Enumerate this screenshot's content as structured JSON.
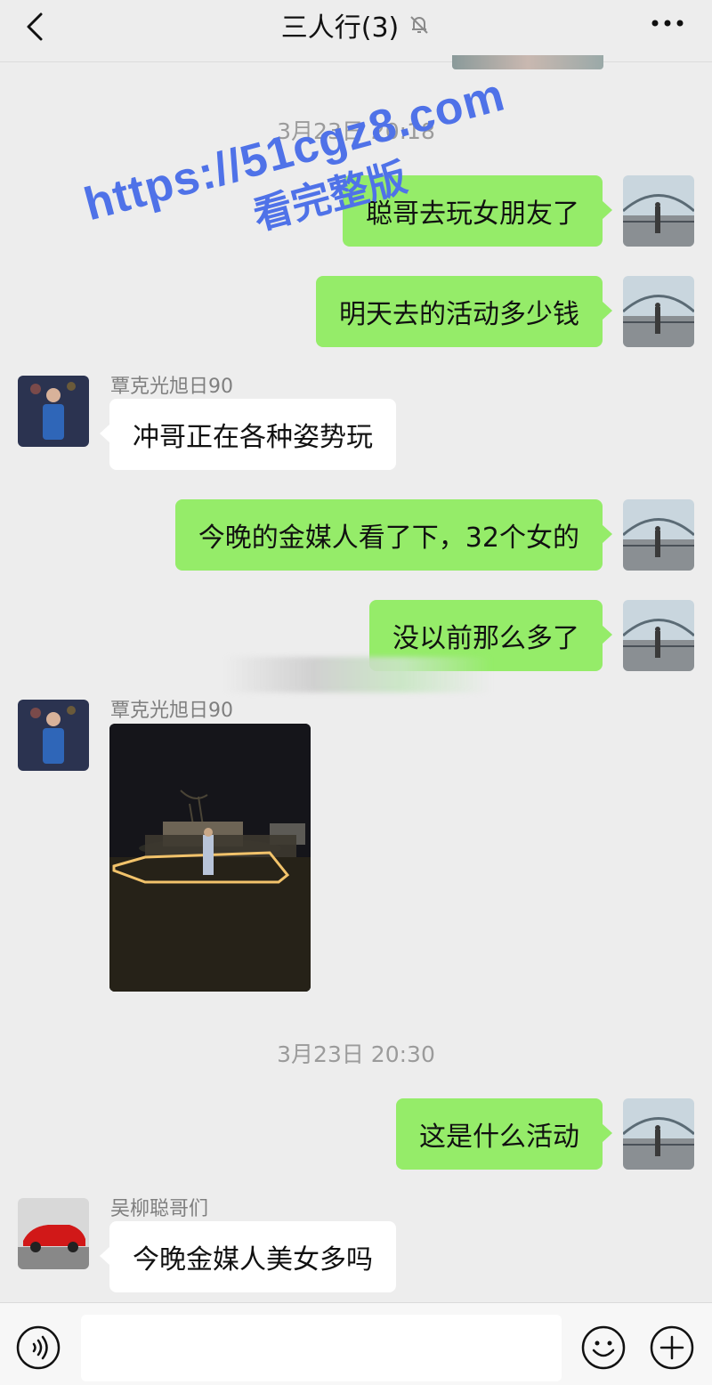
{
  "header": {
    "title": "三人行(3)",
    "back_icon": "chevron-left-icon",
    "mute_icon": "bell-off-icon",
    "more_icon": "more-dots-icon"
  },
  "watermark": {
    "line1": "https://51cgz8.com",
    "line2": "看完整版"
  },
  "timestamps": [
    "3月23日 20:18",
    "3月23日 20:30"
  ],
  "messages": [
    {
      "from": "me",
      "text": "聪哥去玩女朋友了"
    },
    {
      "from": "me",
      "text": "明天去的活动多少钱"
    },
    {
      "from": "other",
      "sender": "覃克光旭日90",
      "text": "冲哥正在各种姿势玩"
    },
    {
      "from": "me",
      "text": "今晚的金媒人看了下，32个女的"
    },
    {
      "from": "me",
      "text": "没以前那么多了"
    },
    {
      "from": "other",
      "sender": "覃克光旭日90",
      "type": "image"
    },
    {
      "from": "me",
      "text": "这是什么活动"
    },
    {
      "from": "other",
      "sender": "吴柳聪哥们",
      "text": "今晚金媒人美女多吗"
    }
  ],
  "input": {
    "value": "",
    "voice_icon": "voice-icon",
    "emoji_icon": "emoji-icon",
    "plus_icon": "plus-icon"
  },
  "colors": {
    "self_bubble": "#95ec69",
    "other_bubble": "#ffffff",
    "background": "#ededed",
    "watermark": "#4f72e8"
  }
}
